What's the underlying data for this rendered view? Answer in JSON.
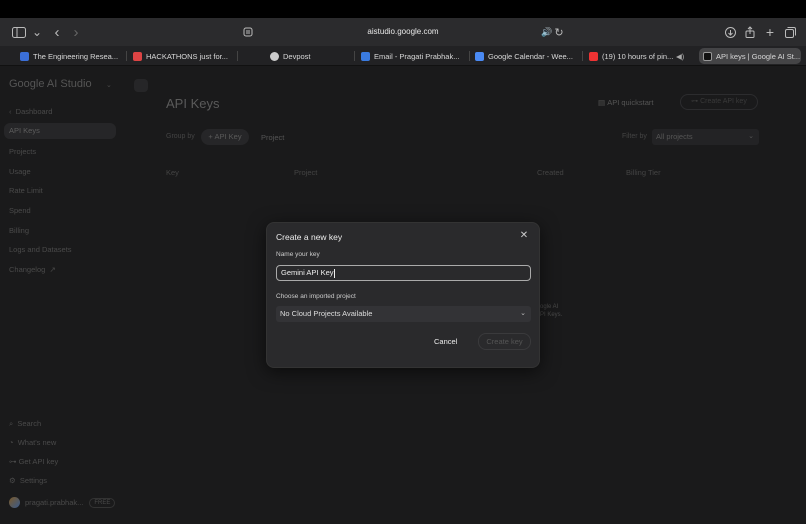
{
  "browser": {
    "url": "aistudio.google.com",
    "tabs": [
      {
        "label": "The Engineering Resea...",
        "color": "#3b6fd8"
      },
      {
        "label": "HACKATHONS just for...",
        "color": "#d44"
      },
      {
        "label": "Devpost",
        "color": "#ccc"
      },
      {
        "label": "Email - Pragati Prabhak...",
        "color": "#3a7be0"
      },
      {
        "label": "Google Calendar - Wee...",
        "color": "#4a8af4"
      },
      {
        "label": "(19) 10 hours of pin...",
        "color": "#e33"
      },
      {
        "label": "API keys | Google AI St...",
        "color": "#999"
      }
    ]
  },
  "sidebar": {
    "logo": "Google AI Studio",
    "back": "Dashboard",
    "items": [
      "API Keys",
      "Projects",
      "Usage",
      "Rate Limit",
      "Spend",
      "Billing",
      "Logs and Datasets",
      "Changelog"
    ],
    "bottom": [
      "Search",
      "What's new",
      "Get API key",
      "Settings"
    ],
    "user": "pragati.prabhak...",
    "user_badge": "FREE"
  },
  "main": {
    "title": "API Keys",
    "quickstart": "API quickstart",
    "create_key_btn": "Create API key",
    "group_by_label": "Group by",
    "group_api_key": "API Key",
    "group_project": "Project",
    "filter_label": "Filter by",
    "filter_value": "All projects",
    "columns": [
      "Key",
      "Project",
      "Created",
      "Billing Tier"
    ],
    "bg_text_1": "ogle AI",
    "bg_text_2": "PI Keys."
  },
  "dialog": {
    "title": "Create a new key",
    "name_label": "Name your key",
    "name_value": "Gemini API Key",
    "project_label": "Choose an imported project",
    "project_value": "No Cloud Projects Available",
    "cancel": "Cancel",
    "create": "Create key"
  }
}
